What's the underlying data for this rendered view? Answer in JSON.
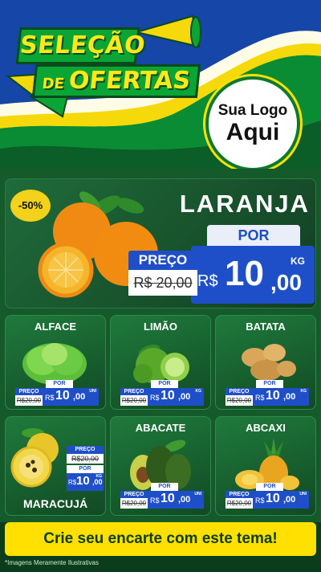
{
  "header": {
    "title_line1": "SELEÇÃO",
    "title_de": "DE",
    "title_ofertas": "OFERTAS",
    "logo_line1": "Sua Logo",
    "logo_line2": "Aqui"
  },
  "featured": {
    "discount": "-50%",
    "name": "LARANJA",
    "por_label": "POR",
    "currency": "R$",
    "price_int": "10",
    "price_dec": ",00",
    "unit": "KG",
    "preco_label": "PREÇO",
    "old_price": "R$ 20,00"
  },
  "products": [
    {
      "name": "ALFACE",
      "preco_label": "PREÇO",
      "old_price": "R$20,00",
      "por_label": "POR",
      "currency": "R$",
      "price_int": "10",
      "price_dec": ",00",
      "unit": "UNI"
    },
    {
      "name": "LIMÃO",
      "preco_label": "PREÇO",
      "old_price": "R$20,00",
      "por_label": "POR",
      "currency": "R$",
      "price_int": "10",
      "price_dec": ",00",
      "unit": "KG"
    },
    {
      "name": "BATATA",
      "preco_label": "PREÇO",
      "old_price": "R$20,00",
      "por_label": "POR",
      "currency": "R$",
      "price_int": "10",
      "price_dec": ",00",
      "unit": "KG"
    },
    {
      "name": "MARACUJÁ",
      "preco_label": "PREÇO",
      "old_price": "R$20,00",
      "por_label": "POR",
      "currency": "R$",
      "price_int": "10",
      "price_dec": ",00",
      "unit": "KG"
    },
    {
      "name": "ABACATE",
      "preco_label": "PREÇO",
      "old_price": "R$20,00",
      "por_label": "POR",
      "currency": "R$",
      "price_int": "10",
      "price_dec": ",00",
      "unit": "UNI"
    },
    {
      "name": "ABCAXI",
      "preco_label": "PREÇO",
      "old_price": "R$20,00",
      "por_label": "POR",
      "currency": "R$",
      "price_int": "10",
      "price_dec": ",00",
      "unit": "UNI"
    }
  ],
  "cta": "Crie seu encarte com este tema!",
  "disclaimer": "*Imagens Meramente Ilustrativas",
  "colors": {
    "green": "#0aa534",
    "yellow": "#ffe000",
    "blue": "#1f4fc8",
    "dark_green": "#0b3d1c"
  }
}
